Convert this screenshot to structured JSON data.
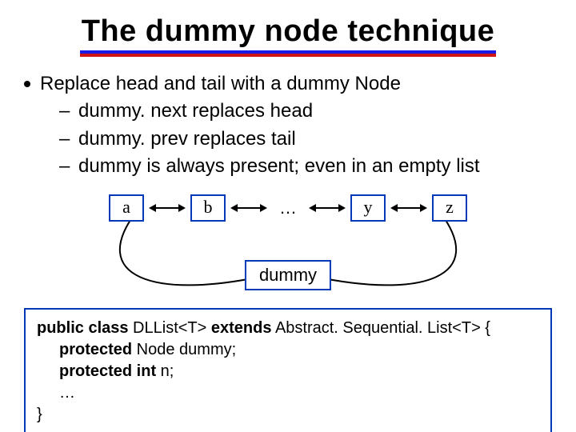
{
  "title": "The dummy node technique",
  "bullets": {
    "main": "Replace head and tail with a dummy Node",
    "sub1": "dummy. next replaces head",
    "sub2": "dummy. prev replaces tail",
    "sub3": "dummy is always present; even in an empty list"
  },
  "nodes": {
    "a": "a",
    "b": "b",
    "dots": "…",
    "y": "y",
    "z": "z"
  },
  "dummy_label": "dummy",
  "code": {
    "kw_public_class": "public class",
    "class_name": " DLList<T> ",
    "kw_extends": "extends",
    "extends_rest": " Abstract. Sequential. List<T> {",
    "kw_protected1": "protected",
    "field1_rest": " Node dummy;",
    "kw_protected2": "protected",
    "kw_int": " int",
    "field2_rest": " n;",
    "ellipsis": "…",
    "close": "}"
  }
}
